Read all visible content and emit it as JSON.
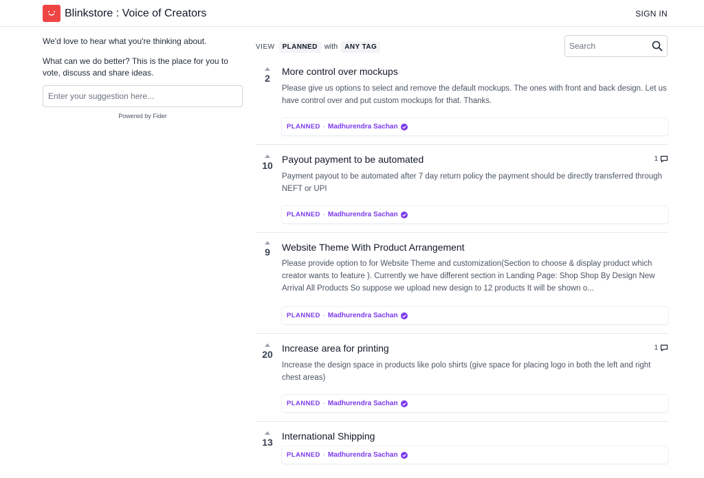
{
  "header": {
    "site_title": "Blinkstore : Voice of Creators",
    "sign_in": "SIGN IN"
  },
  "sidebar": {
    "welcome": "We'd love to hear what you're thinking about.",
    "prompt": "What can we do better? This is the place for you to vote, discuss and share ideas.",
    "suggestion_placeholder": "Enter your suggestion here...",
    "powered_by": "Powered by Fider"
  },
  "filter": {
    "view_label": "VIEW",
    "view_value": "PLANNED",
    "with_label": "with",
    "tag_value": "ANY TAG"
  },
  "search": {
    "placeholder": "Search"
  },
  "posts": [
    {
      "votes": "2",
      "title": "More control over mockups",
      "description": "Please give us options to select and remove the default mockups. The ones with front and back design. Let us have control over and put custom mockups for that. Thanks.",
      "comments": "",
      "status": "PLANNED",
      "author": "Madhurendra Sachan"
    },
    {
      "votes": "10",
      "title": "Payout payment to be automated",
      "description": "Payment payout to be automated after 7 day return policy the payment should be directly transferred through NEFT or UPI",
      "comments": "1",
      "status": "PLANNED",
      "author": "Madhurendra Sachan"
    },
    {
      "votes": "9",
      "title": "Website Theme With Product Arrangement",
      "description": "Please provide option to for Website Theme and customization(Section to choose & display product which creator wants to feature ). Currently we have different section in Landing Page: Shop Shop By Design New Arrival All Products So suppose we upload new design to 12 products It will be shown o...",
      "comments": "",
      "status": "PLANNED",
      "author": "Madhurendra Sachan"
    },
    {
      "votes": "20",
      "title": "Increase area for printing",
      "description": "Increase the design space in products like polo shirts (give space for placing logo in both the left and right chest areas)",
      "comments": "1",
      "status": "PLANNED",
      "author": "Madhurendra Sachan"
    },
    {
      "votes": "13",
      "title": "International Shipping",
      "description": "",
      "comments": "",
      "status": "PLANNED",
      "author": "Madhurendra Sachan"
    }
  ],
  "colors": {
    "brand": "#ef4444",
    "status_purple": "#7c3aed"
  },
  "icons": {
    "logo": "smiley-logo-icon",
    "search": "search-icon",
    "comment": "comment-icon",
    "verified": "verified-badge-icon"
  }
}
